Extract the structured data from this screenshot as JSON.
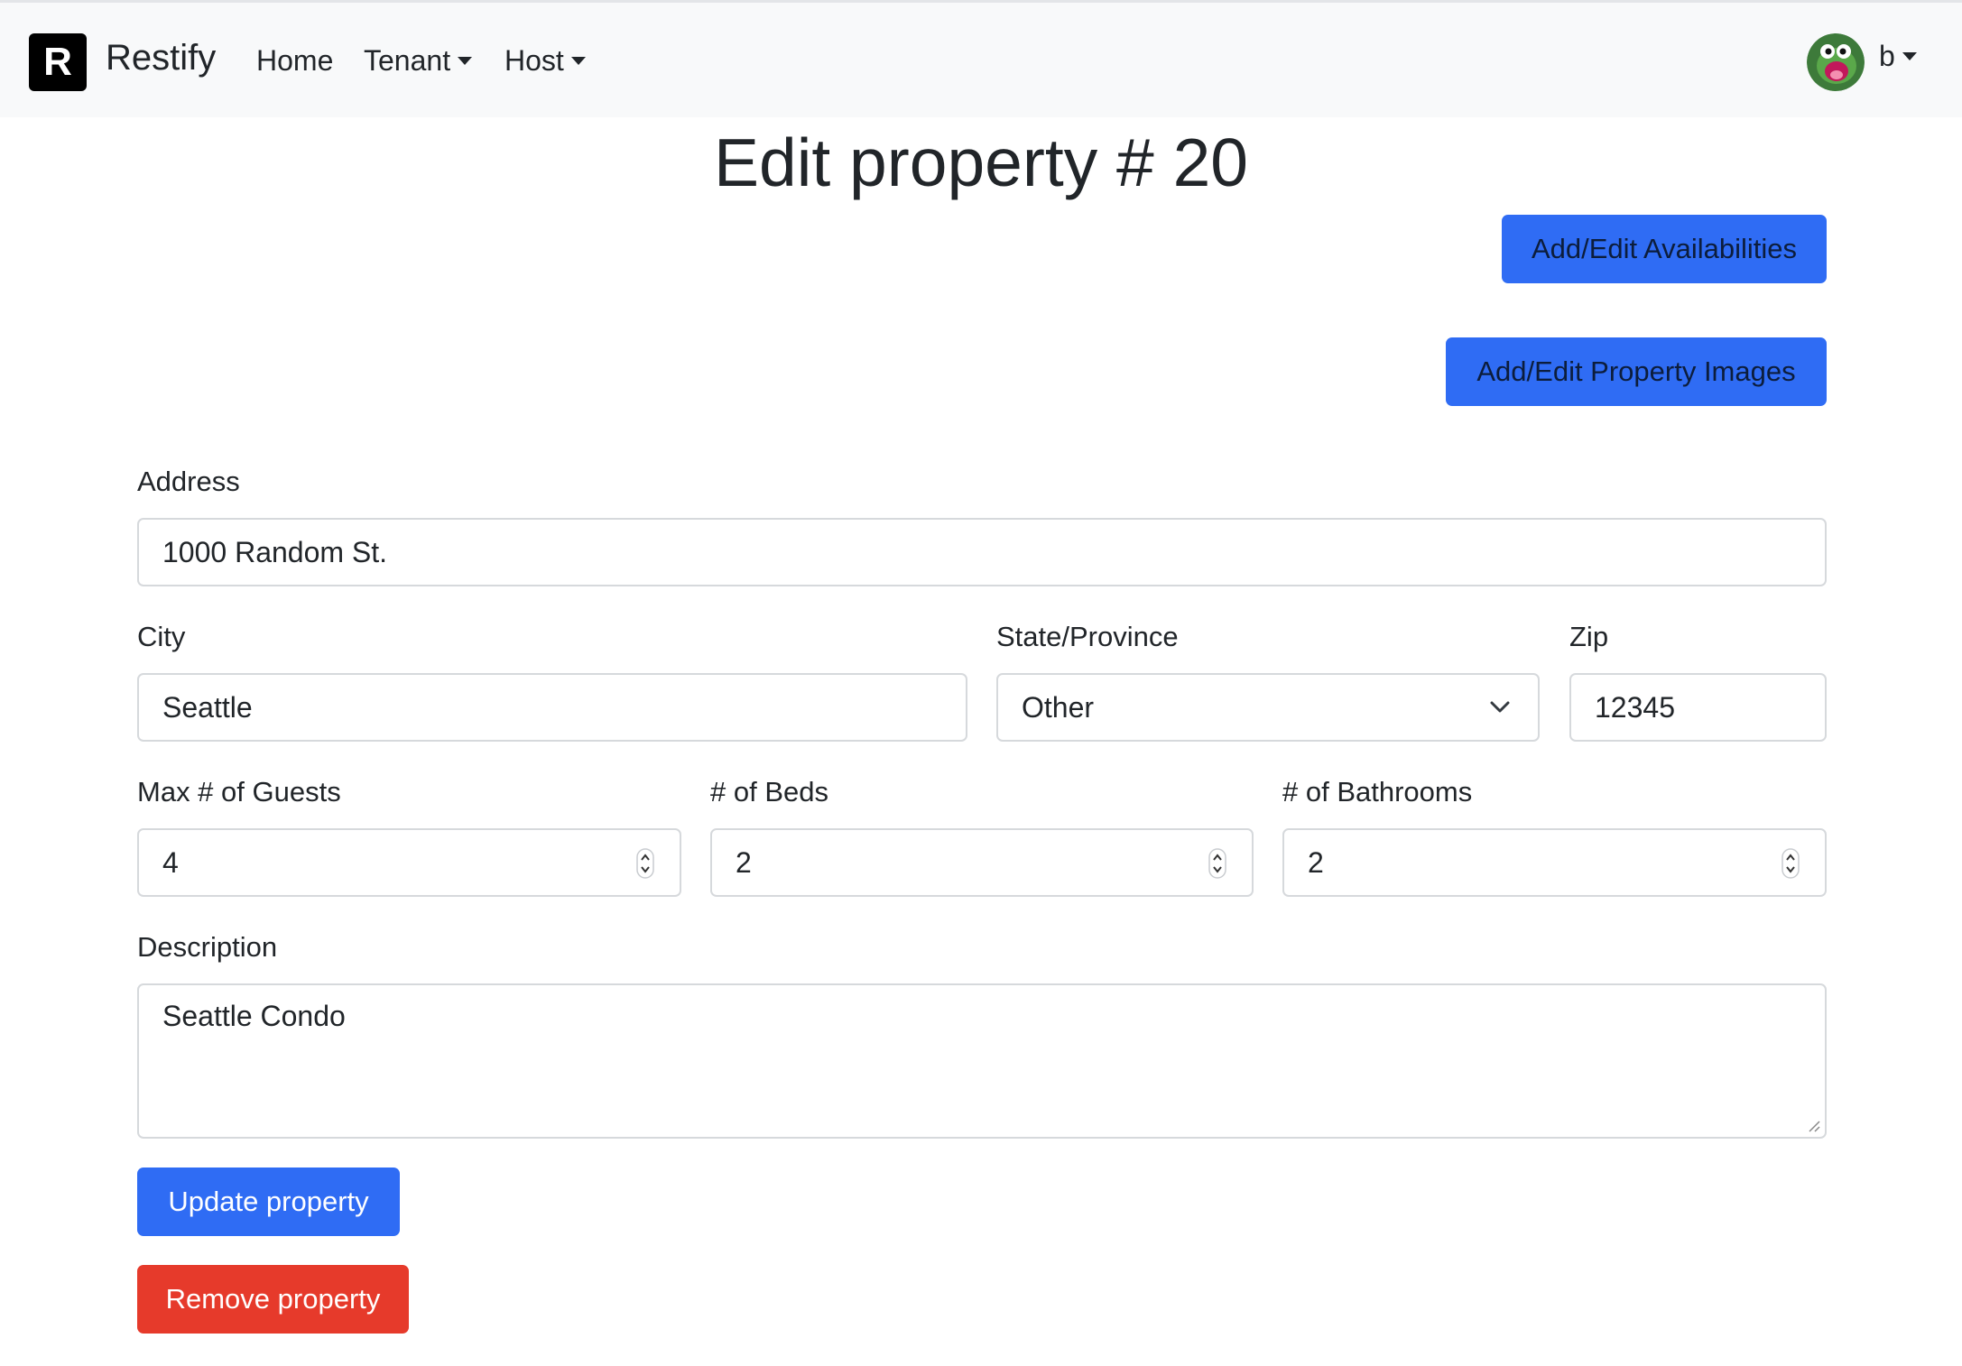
{
  "nav": {
    "brand_letter": "R",
    "brand_name": "Restify",
    "home": "Home",
    "tenant": "Tenant",
    "host": "Host",
    "user": "b"
  },
  "page": {
    "title": "Edit property # 20"
  },
  "actions": {
    "availabilities": "Add/Edit Availabilities",
    "images": "Add/Edit Property Images"
  },
  "form": {
    "address_label": "Address",
    "address_value": "1000 Random St.",
    "city_label": "City",
    "city_value": "Seattle",
    "state_label": "State/Province",
    "state_value": "Other",
    "zip_label": "Zip",
    "zip_value": "12345",
    "guests_label": "Max # of Guests",
    "guests_value": "4",
    "beds_label": "# of Beds",
    "beds_value": "2",
    "baths_label": "# of Bathrooms",
    "baths_value": "2",
    "description_label": "Description",
    "description_value": "Seattle Condo",
    "update_button": "Update property",
    "remove_button": "Remove property"
  },
  "colors": {
    "primary": "#2f6cf4",
    "danger": "#e63a2b",
    "navbar_bg": "#f8f9fa"
  }
}
